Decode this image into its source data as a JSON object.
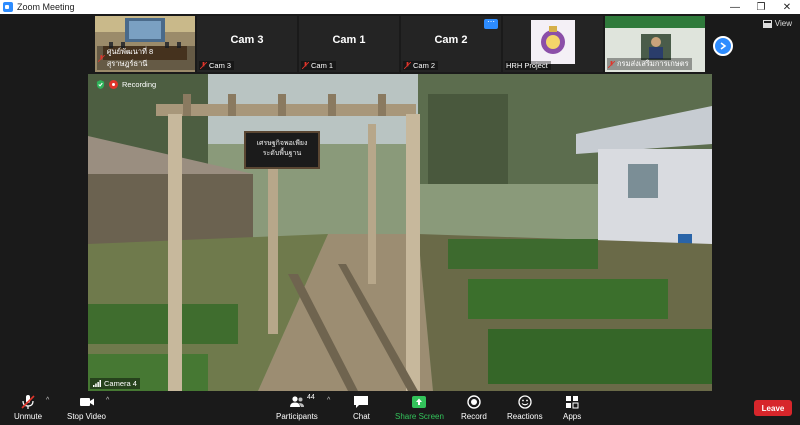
{
  "window": {
    "title": "Zoom Meeting"
  },
  "gallery": {
    "thumbs": [
      {
        "name": "ศูนย์พัฒนาที่ 8 สุราษฎร์ธานี",
        "label": "ศูนย์พัฒนาที่ 8 สุราษฎร์ธานี",
        "big": ""
      },
      {
        "name": "Cam 3",
        "label": "Cam 3",
        "big": "Cam 3"
      },
      {
        "name": "Cam 1",
        "label": "Cam 1",
        "big": "Cam 1"
      },
      {
        "name": "Cam 2",
        "label": "Cam 2",
        "big": "Cam 2"
      },
      {
        "name": "HRH Project",
        "label": "HRH Project",
        "big": ""
      },
      {
        "name": "กรมส่งเสริมการเกษตร",
        "label": "กรมส่งเสริมการเกษตร",
        "big": ""
      }
    ],
    "view_label": "View"
  },
  "main": {
    "recording_label": "Recording",
    "camera_label": "Camera 4",
    "sign_line1": "เศรษฐกิจพอเพียง",
    "sign_line2": "ระดับพื้นฐาน"
  },
  "toolbar": {
    "unmute": "Unmute",
    "stop_video": "Stop Video",
    "participants": "Participants",
    "participants_count": "44",
    "chat": "Chat",
    "share_screen": "Share Screen",
    "record": "Record",
    "reactions": "Reactions",
    "apps": "Apps",
    "leave": "Leave"
  },
  "colors": {
    "accent": "#2d8cff",
    "leave": "#d7262b",
    "share": "#33c35b",
    "muted": "#e0352b"
  }
}
